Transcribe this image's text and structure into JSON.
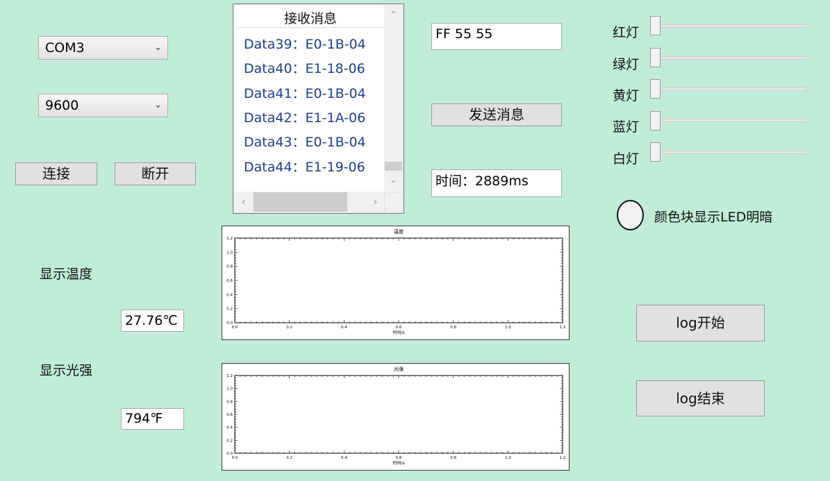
{
  "serial": {
    "port_value": "COM3",
    "baud_value": "9600",
    "connect_label": "连接",
    "disconnect_label": "断开"
  },
  "receive": {
    "header": "接收消息",
    "items": [
      "Data39：E0-1B-04",
      "Data40：E1-18-06",
      "Data41：E0-1B-04",
      "Data42：E1-1A-06",
      "Data43：E0-1B-04",
      "Data44：E1-19-06"
    ]
  },
  "send": {
    "input_value": "FF 55 55",
    "send_label": "发送消息",
    "time_text": "时间：2889ms"
  },
  "leds": {
    "items": [
      {
        "label": "红灯",
        "value": 0
      },
      {
        "label": "绿灯",
        "value": 0
      },
      {
        "label": "黄灯",
        "value": 0
      },
      {
        "label": "蓝灯",
        "value": 0
      },
      {
        "label": "白灯",
        "value": 0
      }
    ],
    "color_block_label": "颜色块显示LED明暗"
  },
  "sensors": {
    "temp_label": "显示温度",
    "temp_value": "27.76℃",
    "light_label": "显示光强",
    "light_value": "794℉"
  },
  "log": {
    "start_label": "log开始",
    "end_label": "log结束"
  },
  "colors": {
    "background": "#c1ecda",
    "list_text": "#1d3f8a"
  },
  "chart_data": [
    {
      "type": "line",
      "title": "温度",
      "xlabel": "时间/s",
      "ylabel": "",
      "xlim": [
        0,
        1.2
      ],
      "ylim": [
        0,
        1.2
      ],
      "xticks": [
        "0.0",
        "0.2",
        "0.4",
        "0.6",
        "0.8",
        "1.0",
        "1.2"
      ],
      "yticks": [
        "0.0",
        "0.2",
        "0.4",
        "0.6",
        "0.8",
        "1.0",
        "1.2"
      ],
      "series": []
    },
    {
      "type": "line",
      "title": "光强",
      "xlabel": "时间/s",
      "ylabel": "",
      "xlim": [
        0,
        1.2
      ],
      "ylim": [
        0,
        1.2
      ],
      "xticks": [
        "0.0",
        "0.2",
        "0.4",
        "0.6",
        "0.8",
        "1.0",
        "1.2"
      ],
      "yticks": [
        "0.0",
        "0.2",
        "0.4",
        "0.6",
        "0.8",
        "1.0",
        "1.2"
      ],
      "series": []
    }
  ]
}
